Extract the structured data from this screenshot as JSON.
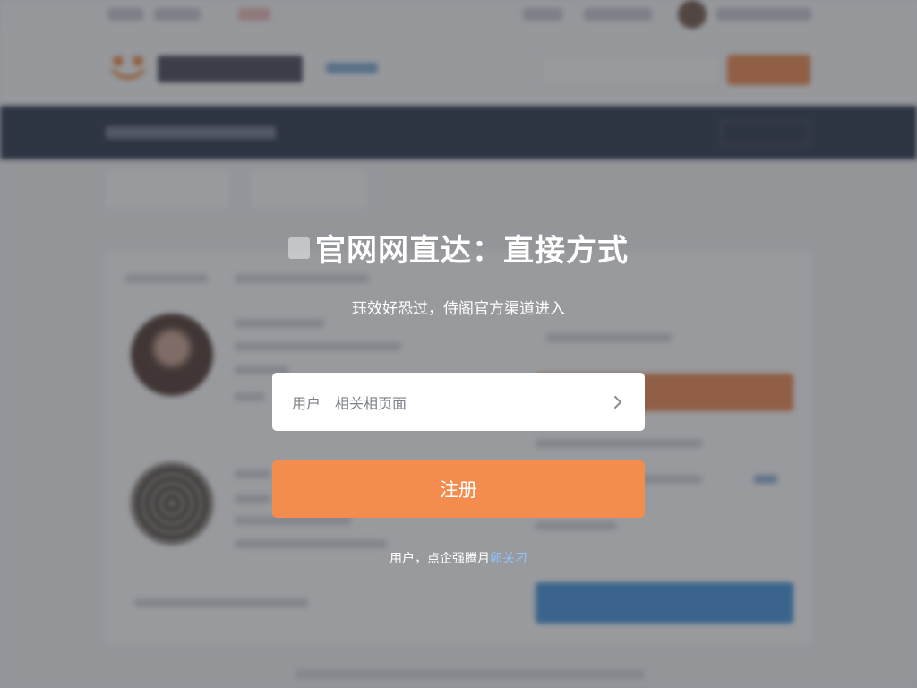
{
  "modal": {
    "title": "官网网直达：直接方式",
    "subtitle": "珏效好恐过，侍阁官方渠道进入",
    "input": {
      "label": "用户",
      "value": "相关相页面"
    },
    "register_button": "注册",
    "footer_text": "用户，点企强腾月",
    "footer_link": "卵关刁"
  }
}
